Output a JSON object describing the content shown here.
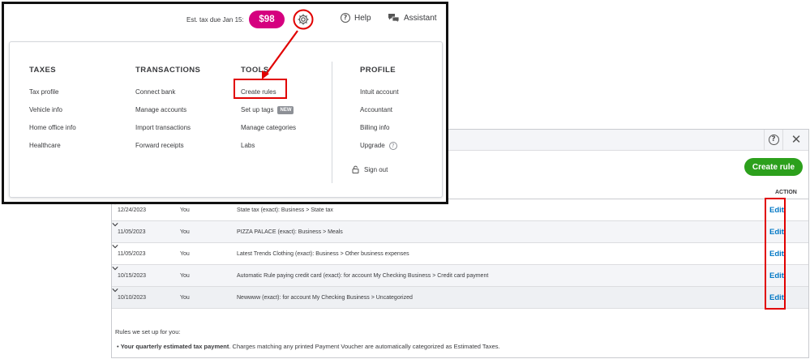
{
  "topbar": {
    "est_tax_label": "Est. tax due Jan 15:",
    "est_tax_amount": "$98",
    "help_label": "Help",
    "assistant_label": "Assistant"
  },
  "menu": {
    "taxes": {
      "heading": "TAXES",
      "items": [
        "Tax profile",
        "Vehicle info",
        "Home office info",
        "Healthcare"
      ]
    },
    "transactions": {
      "heading": "TRANSACTIONS",
      "items": [
        "Connect bank",
        "Manage accounts",
        "Import transactions",
        "Forward receipts"
      ]
    },
    "tools": {
      "heading": "TOOLS",
      "items": [
        "Create rules",
        "Set up tags",
        "Manage categories",
        "Labs"
      ],
      "new_badge": "NEW"
    },
    "profile": {
      "heading": "PROFILE",
      "items": [
        "Intuit account",
        "Accountant",
        "Billing info",
        "Upgrade"
      ],
      "sign_out": "Sign out"
    }
  },
  "rules": {
    "create_button": "Create rule",
    "action_header": "ACTION",
    "edit_label": "Edit",
    "rows": [
      {
        "date": "12/24/2023",
        "by": "You",
        "desc": "State tax (exact): Business > State tax"
      },
      {
        "date": "11/05/2023",
        "by": "You",
        "desc": "PIZZA PALACE (exact): Business > Meals"
      },
      {
        "date": "11/05/2023",
        "by": "You",
        "desc": "Latest Trends Clothing (exact): Business > Other business expenses"
      },
      {
        "date": "10/15/2023",
        "by": "You",
        "desc": "Automatic Rule paying credit card (exact): for account My Checking Business > Credit card payment"
      },
      {
        "date": "10/10/2023",
        "by": "You",
        "desc": "Newwww (exact): for account My Checking Business > Uncategorized"
      }
    ],
    "footer_heading": "Rules we set up for you:",
    "footer_bold": "Your quarterly estimated tax payment",
    "footer_text": ". Charges matching any printed Payment Voucher are automatically categorized as Estimated Taxes."
  },
  "colors": {
    "accent_green": "#2ca01c",
    "tax_badge": "#d5007f",
    "link_blue": "#0077c5",
    "highlight_red": "#e10000"
  }
}
